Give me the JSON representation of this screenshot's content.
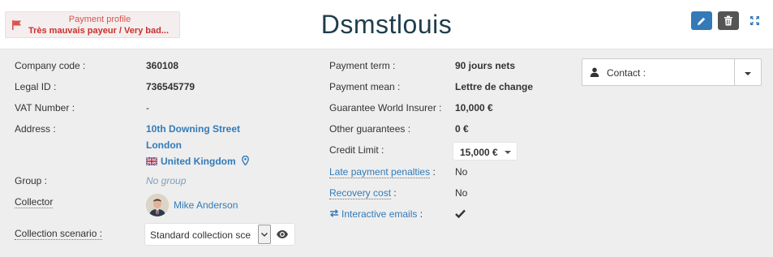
{
  "header": {
    "payment_profile_title": "Payment profile",
    "payment_profile_value": "Très mauvais payeur / Very bad...",
    "company_name": "Dsmstlouis",
    "edit_icon": "pencil-icon",
    "delete_icon": "trash-icon",
    "expand_icon": "expand-icon"
  },
  "left": {
    "company_code_label": "Company code :",
    "company_code": "360108",
    "legal_id_label": "Legal ID :",
    "legal_id": "736545779",
    "vat_label": "VAT Number :",
    "vat": "-",
    "address_label": "Address :",
    "address_line1": "10th Downing Street",
    "address_line2": "London",
    "address_country": "United Kingdom",
    "group_label": "Group :",
    "group_value": "No group",
    "collector_label": "Collector",
    "collector_name": "Mike Anderson",
    "scenario_label": "Collection scenario :",
    "scenario_value": "Standard collection sce"
  },
  "middle": {
    "payment_term_label": "Payment term :",
    "payment_term": "90 jours nets",
    "payment_mean_label": "Payment mean :",
    "payment_mean": "Lettre de change",
    "guarantee_wi_label": "Guarantee World Insurer :",
    "guarantee_wi": "10,000 €",
    "other_guarantees_label": "Other guarantees :",
    "other_guarantees": "0 €",
    "credit_limit_label": "Credit Limit :",
    "credit_limit": "15,000 €",
    "late_penalties_label": "Late payment penalties",
    "late_penalties_colon": ":",
    "late_penalties": "No",
    "recovery_cost_label": "Recovery cost",
    "recovery_cost_colon": ":",
    "recovery_cost": "No",
    "interactive_emails_label": "Interactive emails",
    "interactive_emails_colon": ":"
  },
  "right": {
    "contact_label": "Contact :"
  },
  "colors": {
    "accent": "#337ab7",
    "danger": "#d9534f",
    "panel_bg": "#eeeeee",
    "title": "#1f3d4d"
  }
}
